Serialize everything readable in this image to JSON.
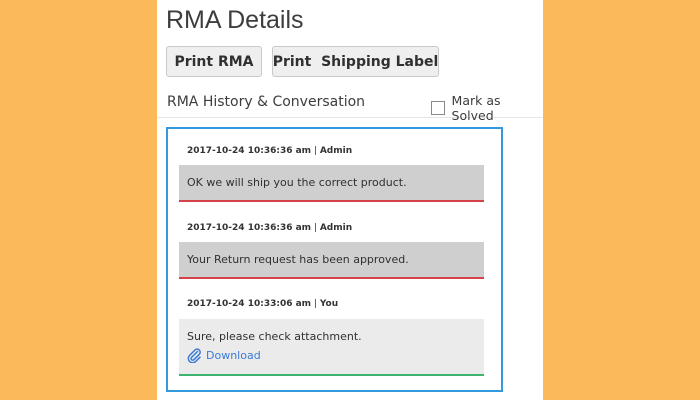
{
  "page": {
    "title": "RMA Details"
  },
  "toolbar": {
    "print_rma": "Print RMA",
    "print_shipping_label": "Print  Shipping Label"
  },
  "history": {
    "title": "RMA History & Conversation",
    "mark_solved_label": "Mark as Solved",
    "mark_solved_checked": false
  },
  "messages": [
    {
      "timestamp": "2017-10-24 10:36:36 am",
      "separator": " | ",
      "author": "Admin",
      "text": "OK we will ship you the correct product."
    },
    {
      "timestamp": "2017-10-24 10:36:36 am",
      "separator": " | ",
      "author": "Admin",
      "text": "Your Return request has been approved."
    },
    {
      "timestamp": "2017-10-24 10:33:06 am",
      "separator": " | ",
      "author": "You",
      "text": "Sure, please check attachment.",
      "attachment_label": "Download"
    }
  ],
  "colors": {
    "background": "#fbb95a",
    "panel": "#ffffff",
    "conversation_border": "#3399dd",
    "admin_message_bg": "#cfcfcf",
    "admin_message_underline": "#d5424a",
    "user_message_bg": "#ebebeb",
    "user_message_underline": "#3cb371",
    "link": "#3a7bd5"
  },
  "icons": {
    "attachment": "paperclip-icon"
  }
}
